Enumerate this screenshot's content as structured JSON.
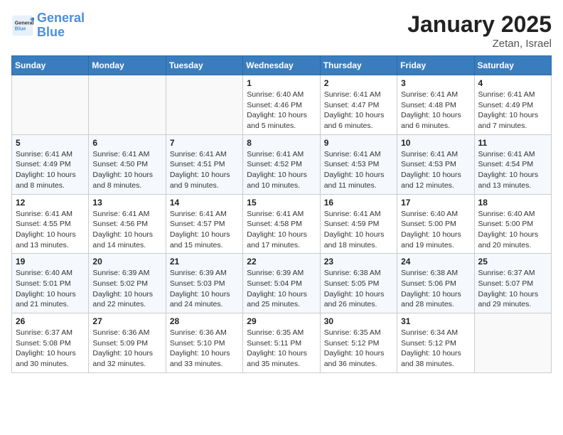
{
  "header": {
    "logo_text_general": "General",
    "logo_text_blue": "Blue",
    "title": "January 2025",
    "subtitle": "Zetan, Israel"
  },
  "calendar": {
    "days_of_week": [
      "Sunday",
      "Monday",
      "Tuesday",
      "Wednesday",
      "Thursday",
      "Friday",
      "Saturday"
    ],
    "weeks": [
      [
        {
          "day": "",
          "info": ""
        },
        {
          "day": "",
          "info": ""
        },
        {
          "day": "",
          "info": ""
        },
        {
          "day": "1",
          "info": "Sunrise: 6:40 AM\nSunset: 4:46 PM\nDaylight: 10 hours\nand 5 minutes."
        },
        {
          "day": "2",
          "info": "Sunrise: 6:41 AM\nSunset: 4:47 PM\nDaylight: 10 hours\nand 6 minutes."
        },
        {
          "day": "3",
          "info": "Sunrise: 6:41 AM\nSunset: 4:48 PM\nDaylight: 10 hours\nand 6 minutes."
        },
        {
          "day": "4",
          "info": "Sunrise: 6:41 AM\nSunset: 4:49 PM\nDaylight: 10 hours\nand 7 minutes."
        }
      ],
      [
        {
          "day": "5",
          "info": "Sunrise: 6:41 AM\nSunset: 4:49 PM\nDaylight: 10 hours\nand 8 minutes."
        },
        {
          "day": "6",
          "info": "Sunrise: 6:41 AM\nSunset: 4:50 PM\nDaylight: 10 hours\nand 8 minutes."
        },
        {
          "day": "7",
          "info": "Sunrise: 6:41 AM\nSunset: 4:51 PM\nDaylight: 10 hours\nand 9 minutes."
        },
        {
          "day": "8",
          "info": "Sunrise: 6:41 AM\nSunset: 4:52 PM\nDaylight: 10 hours\nand 10 minutes."
        },
        {
          "day": "9",
          "info": "Sunrise: 6:41 AM\nSunset: 4:53 PM\nDaylight: 10 hours\nand 11 minutes."
        },
        {
          "day": "10",
          "info": "Sunrise: 6:41 AM\nSunset: 4:53 PM\nDaylight: 10 hours\nand 12 minutes."
        },
        {
          "day": "11",
          "info": "Sunrise: 6:41 AM\nSunset: 4:54 PM\nDaylight: 10 hours\nand 13 minutes."
        }
      ],
      [
        {
          "day": "12",
          "info": "Sunrise: 6:41 AM\nSunset: 4:55 PM\nDaylight: 10 hours\nand 13 minutes."
        },
        {
          "day": "13",
          "info": "Sunrise: 6:41 AM\nSunset: 4:56 PM\nDaylight: 10 hours\nand 14 minutes."
        },
        {
          "day": "14",
          "info": "Sunrise: 6:41 AM\nSunset: 4:57 PM\nDaylight: 10 hours\nand 15 minutes."
        },
        {
          "day": "15",
          "info": "Sunrise: 6:41 AM\nSunset: 4:58 PM\nDaylight: 10 hours\nand 17 minutes."
        },
        {
          "day": "16",
          "info": "Sunrise: 6:41 AM\nSunset: 4:59 PM\nDaylight: 10 hours\nand 18 minutes."
        },
        {
          "day": "17",
          "info": "Sunrise: 6:40 AM\nSunset: 5:00 PM\nDaylight: 10 hours\nand 19 minutes."
        },
        {
          "day": "18",
          "info": "Sunrise: 6:40 AM\nSunset: 5:00 PM\nDaylight: 10 hours\nand 20 minutes."
        }
      ],
      [
        {
          "day": "19",
          "info": "Sunrise: 6:40 AM\nSunset: 5:01 PM\nDaylight: 10 hours\nand 21 minutes."
        },
        {
          "day": "20",
          "info": "Sunrise: 6:39 AM\nSunset: 5:02 PM\nDaylight: 10 hours\nand 22 minutes."
        },
        {
          "day": "21",
          "info": "Sunrise: 6:39 AM\nSunset: 5:03 PM\nDaylight: 10 hours\nand 24 minutes."
        },
        {
          "day": "22",
          "info": "Sunrise: 6:39 AM\nSunset: 5:04 PM\nDaylight: 10 hours\nand 25 minutes."
        },
        {
          "day": "23",
          "info": "Sunrise: 6:38 AM\nSunset: 5:05 PM\nDaylight: 10 hours\nand 26 minutes."
        },
        {
          "day": "24",
          "info": "Sunrise: 6:38 AM\nSunset: 5:06 PM\nDaylight: 10 hours\nand 28 minutes."
        },
        {
          "day": "25",
          "info": "Sunrise: 6:37 AM\nSunset: 5:07 PM\nDaylight: 10 hours\nand 29 minutes."
        }
      ],
      [
        {
          "day": "26",
          "info": "Sunrise: 6:37 AM\nSunset: 5:08 PM\nDaylight: 10 hours\nand 30 minutes."
        },
        {
          "day": "27",
          "info": "Sunrise: 6:36 AM\nSunset: 5:09 PM\nDaylight: 10 hours\nand 32 minutes."
        },
        {
          "day": "28",
          "info": "Sunrise: 6:36 AM\nSunset: 5:10 PM\nDaylight: 10 hours\nand 33 minutes."
        },
        {
          "day": "29",
          "info": "Sunrise: 6:35 AM\nSunset: 5:11 PM\nDaylight: 10 hours\nand 35 minutes."
        },
        {
          "day": "30",
          "info": "Sunrise: 6:35 AM\nSunset: 5:12 PM\nDaylight: 10 hours\nand 36 minutes."
        },
        {
          "day": "31",
          "info": "Sunrise: 6:34 AM\nSunset: 5:12 PM\nDaylight: 10 hours\nand 38 minutes."
        },
        {
          "day": "",
          "info": ""
        }
      ]
    ]
  }
}
